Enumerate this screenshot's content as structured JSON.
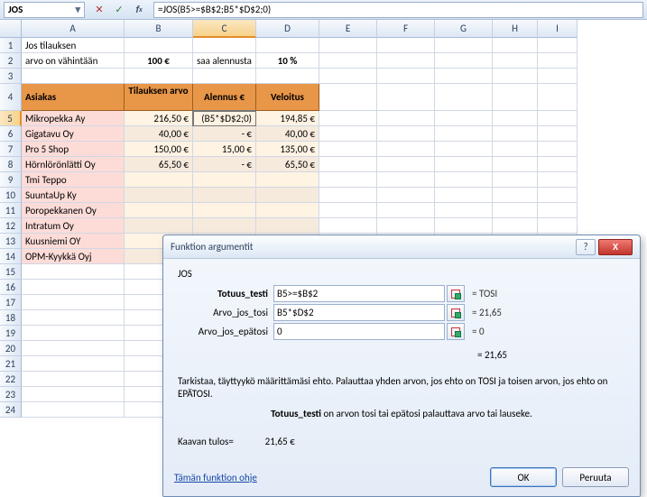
{
  "formulaBar": {
    "name": "JOS",
    "formula": "=JOS(B5>=$B$2;B5*$D$2;0)"
  },
  "cols": [
    "A",
    "B",
    "C",
    "D",
    "E",
    "F",
    "G",
    "H",
    "I"
  ],
  "selCol": "C",
  "selRow": 5,
  "r1": {
    "A": "Jos tilauksen"
  },
  "r2": {
    "A": "arvo on vähintään",
    "B": "100 €",
    "C": "saa alennusta",
    "D": "10 %"
  },
  "r4": {
    "A": "Asiakas",
    "B": "Tilauksen arvo",
    "C": "Alennus €",
    "D": "Veloitus"
  },
  "r5": {
    "A": "Mikropekka Ay",
    "B": "216,50 €",
    "C": "(B5*$D$2;0)",
    "D": "194,85 €"
  },
  "r6": {
    "A": "Gigatavu Oy",
    "B": "40,00 €",
    "C": "-    €",
    "D": "40,00 €"
  },
  "r7": {
    "A": "Pro 5 Shop",
    "B": "150,00 €",
    "C": "15,00 €",
    "D": "135,00 €"
  },
  "r8": {
    "A": "Hörnlörönlätti Oy",
    "B": "65,50 €",
    "C": "-    €",
    "D": "65,50 €"
  },
  "r9": {
    "A": "Tmi Teppo"
  },
  "r10": {
    "A": "SuuntaUp Ky"
  },
  "r11": {
    "A": "Poropekkanen Oy"
  },
  "r12": {
    "A": "Intratum Oy"
  },
  "r13": {
    "A": "Kuusniemi OY"
  },
  "r14": {
    "A": "OPM-Kyykkä Oyj"
  },
  "dlg": {
    "title": "Funktion argumentit",
    "fn": "JOS",
    "args": [
      {
        "label": "Totuus_testi",
        "val": "B5>=$B$2",
        "res": "=  TOSI",
        "bold": true
      },
      {
        "label": "Arvo_jos_tosi",
        "val": "B5*$D$2",
        "res": "=  21,65",
        "bold": false
      },
      {
        "label": "Arvo_jos_epätosi",
        "val": "0",
        "res": "=  0",
        "bold": false
      }
    ],
    "total": "=  21,65",
    "desc": "Tarkistaa, täyttyykö määrittämäsi ehto. Palauttaa yhden arvon, jos ehto on TOSI ja toisen arvon, jos ehto on EPÄTOSI.",
    "paramName": "Totuus_testi",
    "paramDesc": " on arvon tosi tai epätosi palauttava arvo tai lauseke.",
    "resultLbl": "Kaavan tulos=",
    "resultVal": "21,65 €",
    "help": "Tämän funktion ohje",
    "ok": "OK",
    "cancel": "Peruuta"
  }
}
